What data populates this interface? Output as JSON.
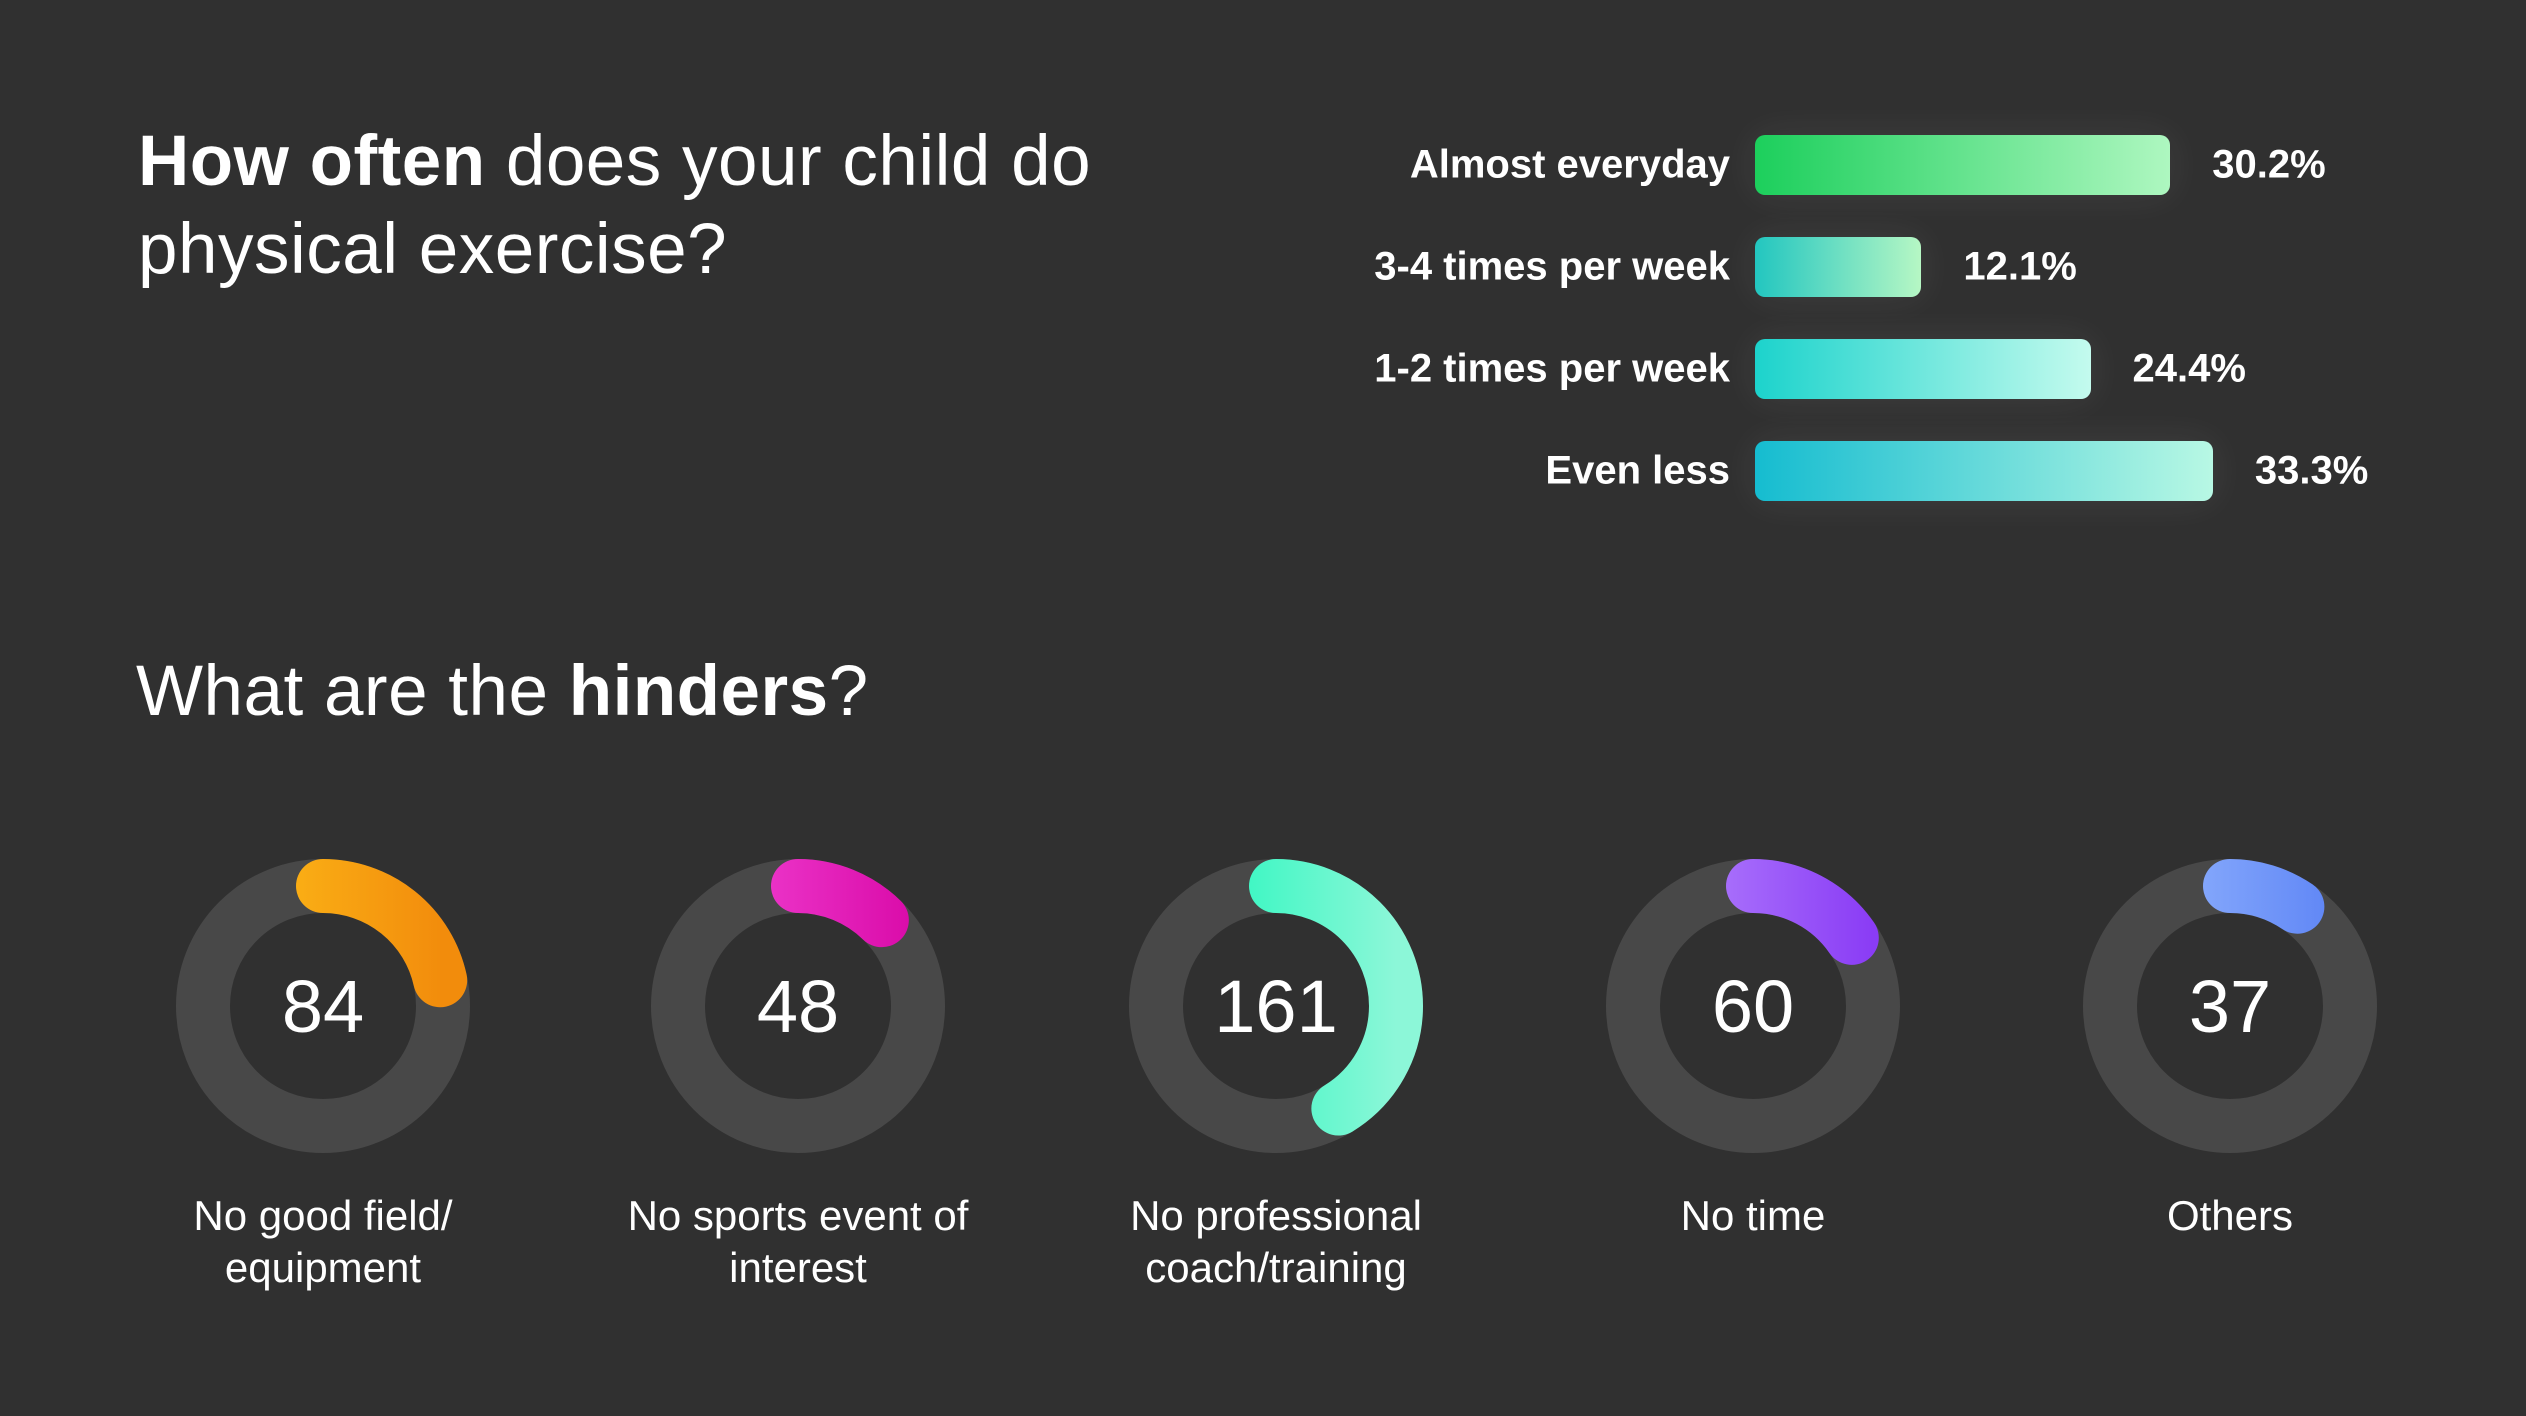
{
  "headline": {
    "bold": "How often",
    "rest": " does your child do physical exercise?"
  },
  "subhead": {
    "pre": "What are the ",
    "bold": "hinders",
    "post": "?"
  },
  "chart_data": [
    {
      "type": "bar",
      "orientation": "horizontal",
      "categories": [
        "Almost everyday",
        "3-4 times per week",
        "1-2 times per week",
        "Even less"
      ],
      "values": [
        30.2,
        12.1,
        24.4,
        33.3
      ],
      "value_labels": [
        "30.2%",
        "12.1%",
        "24.4%",
        "33.3%"
      ],
      "unit": "%",
      "colors": [
        [
          "#1ccf5c",
          "#aef7c0"
        ],
        [
          "#22c6c0",
          "#b6f7c4"
        ],
        [
          "#1cd3cc",
          "#c4fbee"
        ],
        [
          "#15bcd0",
          "#b8f8e4"
        ]
      ]
    },
    {
      "type": "donut",
      "total": 390,
      "categories": [
        "No good field/ equipment",
        "No sports event of interest",
        "No professional coach/training",
        "No time",
        "Others"
      ],
      "values": [
        84,
        48,
        161,
        60,
        37
      ],
      "value_labels": [
        "84",
        "48",
        "161",
        "60",
        "37"
      ],
      "colors": [
        [
          "#ffc21a",
          "#f28c0c"
        ],
        [
          "#f54bd9",
          "#d90aa8"
        ],
        [
          "#12f7b8",
          "#8cf7d8"
        ],
        [
          "#b98cff",
          "#8a3cf5"
        ],
        [
          "#9bbcff",
          "#5b82f5"
        ]
      ],
      "track_color": "#484848"
    }
  ]
}
